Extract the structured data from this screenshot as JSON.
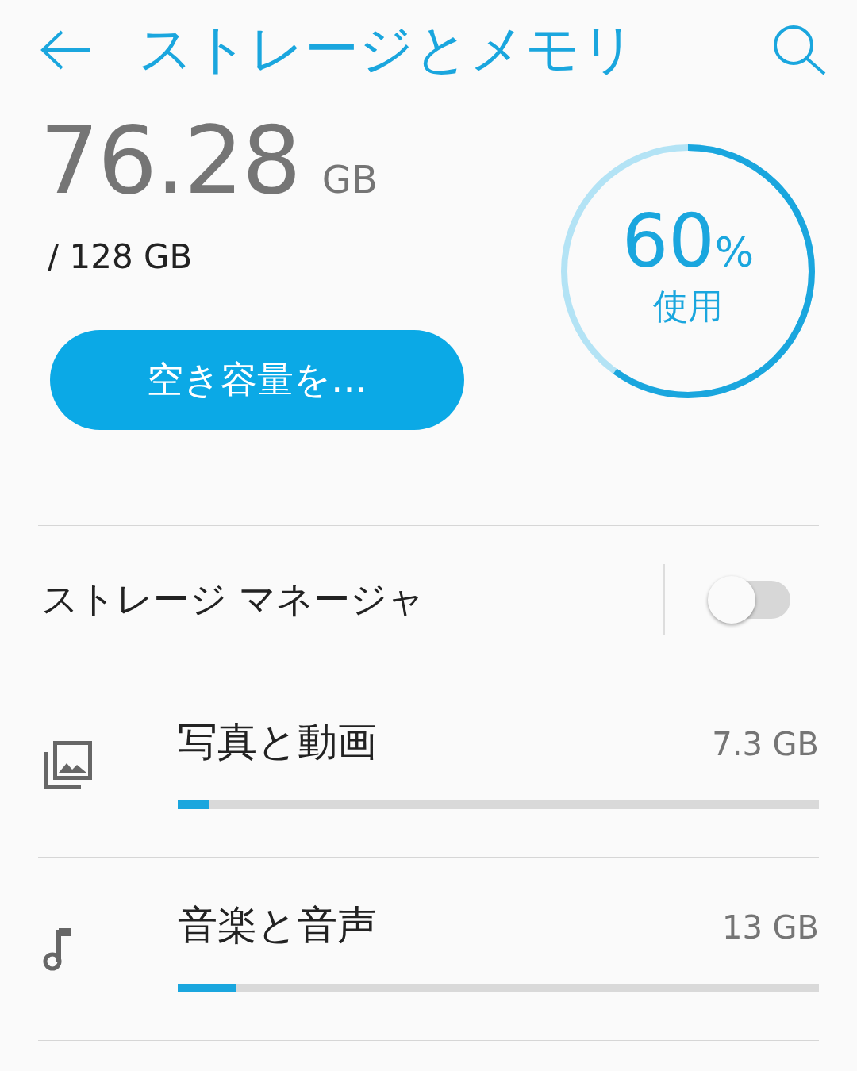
{
  "app_bar": {
    "title": "ストレージとメモリ"
  },
  "summary": {
    "used": "76.28",
    "used_unit": "GB",
    "total": "/ 128 GB",
    "meter": {
      "percent": "60",
      "percent_sign": "%",
      "caption": "使用"
    },
    "free_button": "空き容量を…"
  },
  "storage_manager": {
    "label": "ストレージ マネージャ",
    "on": false
  },
  "items": [
    {
      "kind": "photos",
      "label": "写真と動画",
      "size": "7.3 GB",
      "level": 0.05
    },
    {
      "kind": "music",
      "label": "音楽と音声",
      "size": "13 GB",
      "level": 0.09
    }
  ]
}
